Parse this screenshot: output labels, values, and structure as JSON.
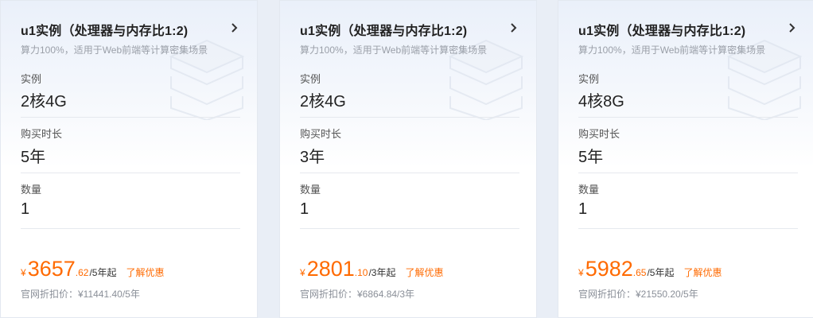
{
  "cards": [
    {
      "title": "u1实例（处理器与内存比1:2)",
      "subtitle": "算力100%，适用于Web前端等计算密集场景",
      "instance_label": "实例",
      "instance_value": "2核4G",
      "duration_label": "购买时长",
      "duration_value": "5年",
      "quantity_label": "数量",
      "quantity_value": "1",
      "currency": "¥",
      "price_int": "3657",
      "price_dec": ".62",
      "price_unit": "/5年起",
      "promo": "了解优惠",
      "list_price": "官网折扣价：¥11441.40/5年"
    },
    {
      "title": "u1实例（处理器与内存比1:2)",
      "subtitle": "算力100%，适用于Web前端等计算密集场景",
      "instance_label": "实例",
      "instance_value": "2核4G",
      "duration_label": "购买时长",
      "duration_value": "3年",
      "quantity_label": "数量",
      "quantity_value": "1",
      "currency": "¥",
      "price_int": "2801",
      "price_dec": ".10",
      "price_unit": "/3年起",
      "promo": "了解优惠",
      "list_price": "官网折扣价：¥6864.84/3年"
    },
    {
      "title": "u1实例（处理器与内存比1:2)",
      "subtitle": "算力100%，适用于Web前端等计算密集场景",
      "instance_label": "实例",
      "instance_value": "4核8G",
      "duration_label": "购买时长",
      "duration_value": "5年",
      "quantity_label": "数量",
      "quantity_value": "1",
      "currency": "¥",
      "price_int": "5982",
      "price_dec": ".65",
      "price_unit": "/5年起",
      "promo": "了解优惠",
      "list_price": "官网折扣价：¥21550.20/5年"
    }
  ],
  "colors": {
    "accent": "#ff6a00",
    "background": "#e9eef6",
    "card_top": "#eaf0fa"
  },
  "icons": {
    "chevron": "chevron-right-icon",
    "decoration": "server-stack-icon"
  }
}
